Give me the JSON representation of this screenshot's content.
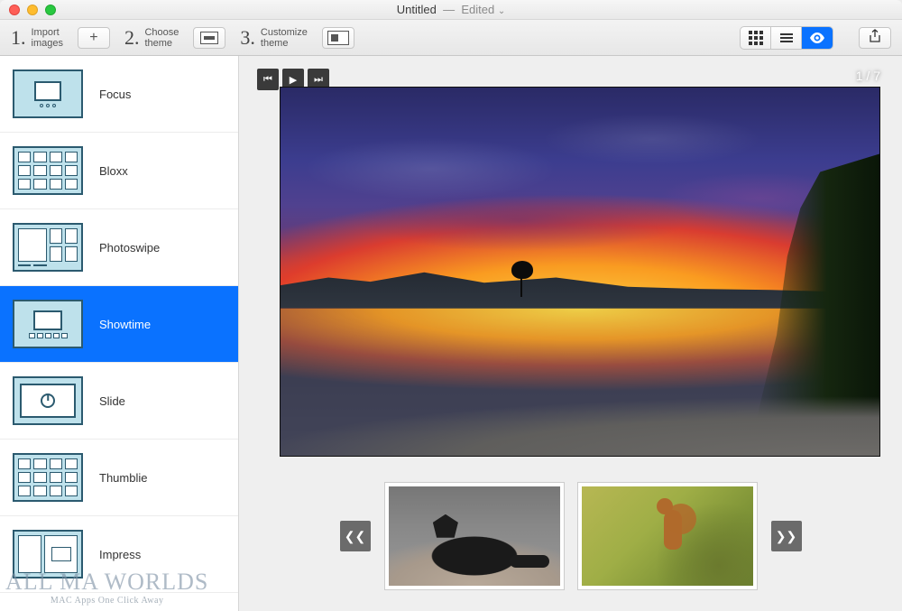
{
  "window": {
    "title": "Untitled",
    "sep": "—",
    "status": "Edited"
  },
  "steps": {
    "s1": {
      "num": "1.",
      "line1": "Import",
      "line2": "images"
    },
    "s2": {
      "num": "2.",
      "line1": "Choose",
      "line2": "theme"
    },
    "s3": {
      "num": "3.",
      "line1": "Customize",
      "line2": "theme"
    }
  },
  "icons": {
    "plus": "+"
  },
  "themes": [
    {
      "label": "Focus"
    },
    {
      "label": "Bloxx"
    },
    {
      "label": "Photoswipe"
    },
    {
      "label": "Showtime"
    },
    {
      "label": "Slide"
    },
    {
      "label": "Thumblie"
    },
    {
      "label": "Impress"
    }
  ],
  "preview": {
    "counter": "1 / 7"
  },
  "watermark": {
    "main": "ALL MA   WORLDS",
    "sub": "MAC Apps One Click Away"
  }
}
